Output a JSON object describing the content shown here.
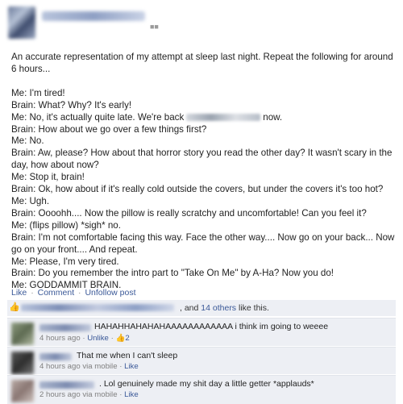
{
  "post": {
    "intro": "An accurate representation of my attempt at sleep last night. Repeat the following for around 6 hours...",
    "lines": [
      "Me: I'm tired!",
      "Brain: What? Why? It's early!",
      "Me: No, it's actually quite late. We're back",
      "now.",
      "Brain: How about we go over a few things first?",
      "Me: No.",
      "Brain: Aw, please? How about that horror story you read the other day? It wasn't scary in the day, how about now?",
      "Me: Stop it, brain!",
      "Brain: Ok, how about if it's really cold outside the covers, but under the covers it's too hot?",
      "Me: Ugh.",
      "Brain: Oooohh.... Now the pillow is really scratchy and uncomfortable! Can you feel it?",
      "Me: (flips pillow) *sigh* no.",
      "Brain: I'm not comfortable facing this way. Face the other way.... Now go on your back... Now go on your front.... And repeat.",
      "Me: Please, I'm very tired.",
      "Brain: Do you remember the intro part to \"Take On Me\" by A-Ha? Now you do!",
      "Me: GODDAMMIT BRAIN."
    ]
  },
  "actions": {
    "like": "Like",
    "sep": "·",
    "comment": "Comment",
    "unfollow": "Unfollow post"
  },
  "likes": {
    "prefix": ", and",
    "others_link": "14 others",
    "suffix": "like this."
  },
  "comments": [
    {
      "text": "HAHAHHAHAHAHAAAAAAAAAAAA i think im going to weeee",
      "time": "4 hours ago",
      "sep": "·",
      "action": "Unlike",
      "sep2": "·",
      "like_count": "2",
      "avatar_color": "#7a8a6a"
    },
    {
      "text": "That me when I can't sleep",
      "time": "4 hours ago via mobile",
      "sep": "·",
      "action": "Like",
      "avatar_color": "#4a4a4a"
    },
    {
      "text": ". Lol genuinely made my shit day a little getter *applauds*",
      "time": "2 hours ago via mobile",
      "sep": "·",
      "action": "Like",
      "avatar_color": "#9a8a86"
    }
  ],
  "colors": {
    "link": "#3b5998",
    "panel": "#edeff4"
  }
}
